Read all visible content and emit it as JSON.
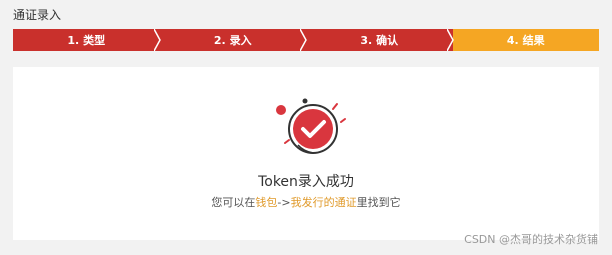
{
  "page": {
    "title": "通证录入"
  },
  "steps": [
    {
      "label": "1. 类型",
      "state": "done"
    },
    {
      "label": "2. 录入",
      "state": "done"
    },
    {
      "label": "3. 确认",
      "state": "done"
    },
    {
      "label": "4. 结果",
      "state": "active"
    }
  ],
  "result": {
    "icon": "check-circle-icon",
    "title": "Token录入成功",
    "hint_prefix": "您可以在",
    "hint_link1": "钱包",
    "hint_arrow": "->",
    "hint_link2": "我发行的通证",
    "hint_suffix": "里找到它"
  },
  "colors": {
    "done": "#c9302c",
    "active": "#f5a623",
    "link": "#e09a2b",
    "success_red": "#d9363e"
  },
  "watermark": "CSDN @杰哥的技术杂货铺"
}
